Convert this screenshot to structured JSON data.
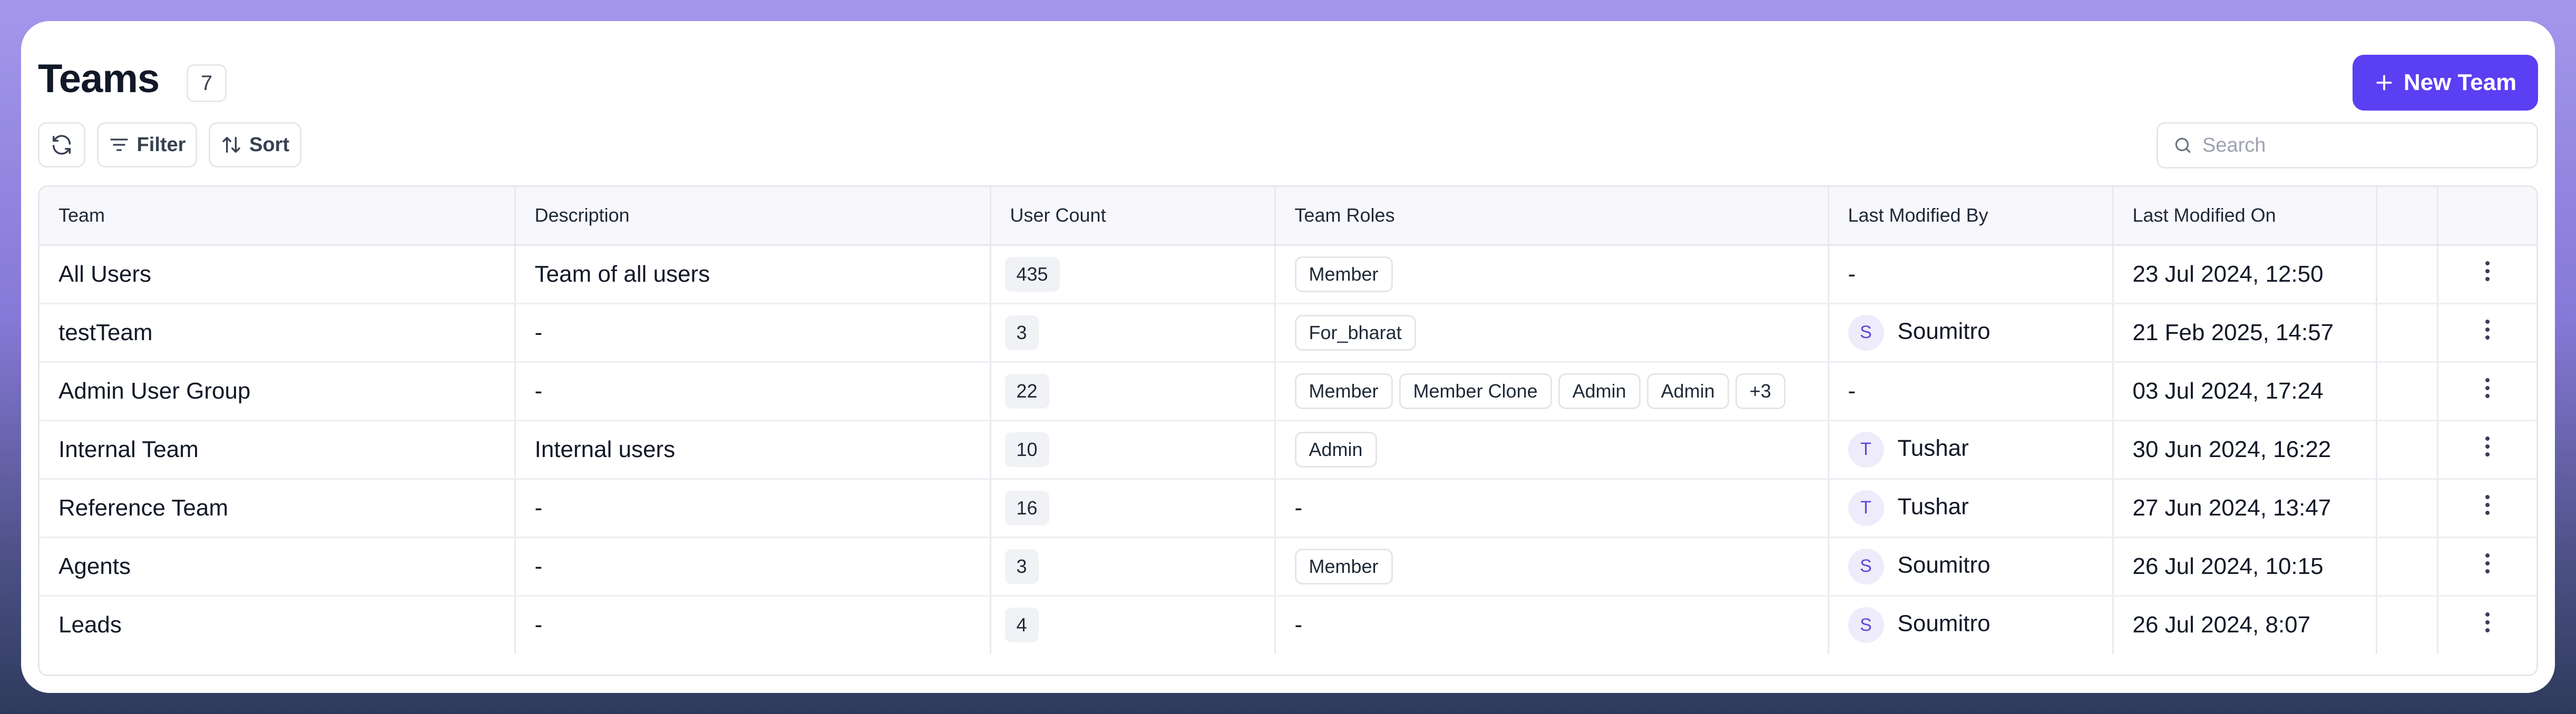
{
  "header": {
    "title": "Teams",
    "count": "7",
    "new_team_label": "New Team"
  },
  "toolbar": {
    "filter_label": "Filter",
    "sort_label": "Sort",
    "search_placeholder": "Search"
  },
  "table": {
    "columns": [
      "Team",
      "Description",
      "User Count",
      "Team Roles",
      "Last Modified By",
      "Last Modified On"
    ],
    "rows": [
      {
        "team": "All Users",
        "description": "Team of all users",
        "user_count": "435",
        "roles": [
          "Member"
        ],
        "modified_by": "-",
        "avatar": "",
        "modified_on": "23 Jul 2024, 12:50"
      },
      {
        "team": "testTeam",
        "description": "-",
        "user_count": "3",
        "roles": [
          "For_bharat"
        ],
        "modified_by": "Soumitro",
        "avatar": "S",
        "modified_on": "21 Feb 2025, 14:57"
      },
      {
        "team": "Admin User Group",
        "description": "-",
        "user_count": "22",
        "roles": [
          "Member",
          "Member Clone",
          "Admin",
          "Admin",
          "+3"
        ],
        "modified_by": "-",
        "avatar": "",
        "modified_on": "03 Jul 2024, 17:24"
      },
      {
        "team": "Internal Team",
        "description": "Internal users",
        "user_count": "10",
        "roles": [
          "Admin"
        ],
        "modified_by": "Tushar",
        "avatar": "T",
        "modified_on": "30 Jun 2024, 16:22"
      },
      {
        "team": "Reference Team",
        "description": "-",
        "user_count": "16",
        "roles": [],
        "roles_empty": "-",
        "modified_by": "Tushar",
        "avatar": "T",
        "modified_on": "27 Jun 2024, 13:47"
      },
      {
        "team": "Agents",
        "description": "-",
        "user_count": "3",
        "roles": [
          "Member"
        ],
        "modified_by": "Soumitro",
        "avatar": "S",
        "modified_on": "26 Jul 2024, 10:15"
      },
      {
        "team": "Leads",
        "description": "-",
        "user_count": "4",
        "roles": [],
        "roles_empty": "-",
        "modified_by": "Soumitro",
        "avatar": "S",
        "modified_on": "26 Jul 2024, 8:07"
      }
    ]
  },
  "icons": {
    "refresh": "refresh-icon",
    "filter": "filter-icon",
    "sort": "sort-icon",
    "search": "search-icon",
    "plus": "plus-icon",
    "more": "kebab-menu-icon"
  },
  "colors": {
    "accent": "#5b3ff2",
    "avatar_bg": "#eeebfb",
    "avatar_text": "#5b48d6"
  }
}
